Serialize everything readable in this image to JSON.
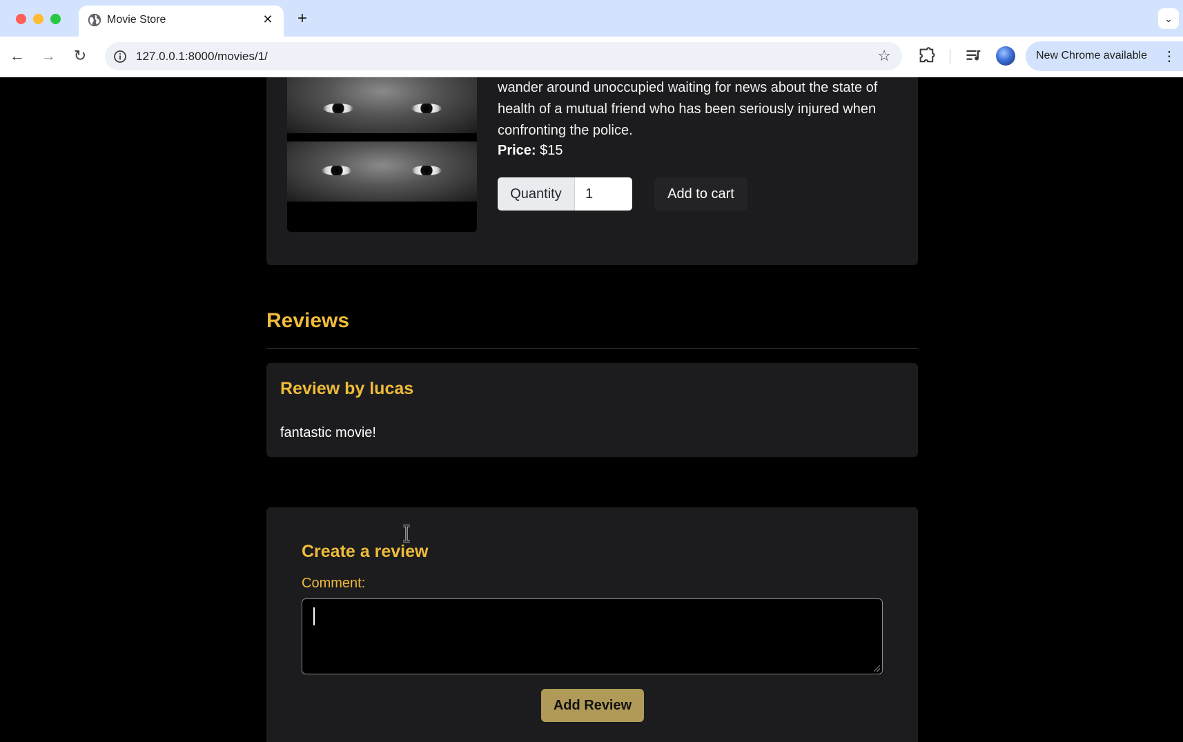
{
  "browser": {
    "tab": {
      "title": "Movie Store",
      "close_glyph": "✕"
    },
    "new_tab_glyph": "+",
    "tab_search_glyph": "⌄",
    "nav": {
      "back_glyph": "←",
      "forward_glyph": "→",
      "reload_glyph": "↻"
    },
    "omnibox": {
      "url": "127.0.0.1:8000/movies/1/",
      "bookmark_glyph": "☆"
    },
    "update_button": {
      "label": "New Chrome available",
      "menu_glyph": "⋮"
    },
    "icons": [
      "globe-icon",
      "info-icon",
      "star-icon",
      "extensions-icon",
      "media-control-icon",
      "profile-avatar",
      "kebab-menu-icon"
    ]
  },
  "movie": {
    "description": "wander around unoccupied waiting for news about the state of health of a mutual friend who has been seriously injured when confronting the police.",
    "price_label": "Price:",
    "price_value": "$15",
    "quantity_label": "Quantity",
    "quantity_value": "1",
    "add_to_cart_label": "Add to cart"
  },
  "reviews": {
    "heading": "Reviews",
    "items": [
      {
        "title": "Review by lucas",
        "text": "fantastic movie!"
      }
    ]
  },
  "create_review": {
    "title": "Create a review",
    "comment_label": "Comment:",
    "comment_value": "",
    "submit_label": "Add Review"
  },
  "colors": {
    "accent": "#efbb39",
    "card_background": "#1c1c1e",
    "page_background": "#000000",
    "submit_button": "#b09a58",
    "chrome_tabstrip": "#d3e3fd"
  }
}
